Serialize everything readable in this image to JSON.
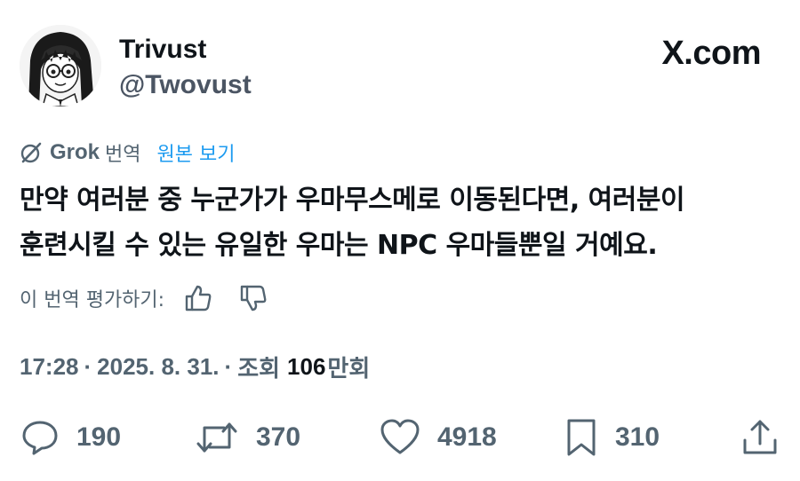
{
  "author": {
    "name": "Trivust",
    "handle": "@Twovust",
    "avatar_icon": "manga-girl-avatar-icon"
  },
  "brand": {
    "label": "X.com",
    "logo_icon": "x-logo-icon"
  },
  "translation": {
    "provider_icon": "grok-icon",
    "provider_name": "Grok",
    "provider_suffix": "번역",
    "view_original_label": "원본 보기",
    "link_color": "#1d9bf0"
  },
  "tweet": {
    "lines": [
      "만약 여러분 중 누군가가 우마무스메로 이동된다면, 여러분이",
      "훈련시킬 수 있는 유일한 우마는 NPC 우마들뿐일 거예요."
    ]
  },
  "rating": {
    "label": "이 번역 평가하기:",
    "thumbs_up_icon": "thumbs-up-icon",
    "thumbs_down_icon": "thumbs-down-icon"
  },
  "meta": {
    "time": "17:28",
    "separator": "·",
    "date": "2025. 8. 31.",
    "views_prefix": "조회",
    "views_number": "106",
    "views_suffix": "만회"
  },
  "actions": {
    "replies": "190",
    "reposts": "370",
    "likes": "4918",
    "bookmarks": "310",
    "reply_icon": "reply-icon",
    "repost_icon": "repost-icon",
    "like_icon": "heart-icon",
    "bookmark_icon": "bookmark-icon",
    "share_icon": "share-icon"
  }
}
